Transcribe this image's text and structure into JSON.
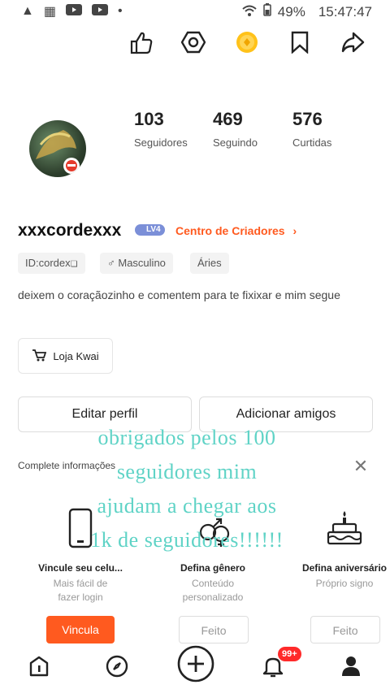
{
  "status_bar": {
    "battery": "49%",
    "time": "15:47:47"
  },
  "top_icons": [
    "like-icon",
    "settings-icon",
    "coin-icon",
    "bookmark-icon",
    "share-icon"
  ],
  "stats": [
    {
      "value": "103",
      "label": "Seguidores"
    },
    {
      "value": "469",
      "label": "Seguindo"
    },
    {
      "value": "576",
      "label": "Curtidas"
    }
  ],
  "profile": {
    "username": "xxxcordexxx",
    "level": "LV4",
    "creator_center": "Centro de Criadores",
    "chips": [
      "ID:cordex",
      "Masculino",
      "Áries"
    ],
    "bio": "deixem o coraçãozinho e comentem para te fixixar e mim segue",
    "shop_label": "Loja Kwai"
  },
  "actions": {
    "edit": "Editar perfil",
    "add_friends": "Adicionar amigos"
  },
  "complete_info": {
    "label": "Complete informações",
    "cards": [
      {
        "title": "Vincule seu celu...",
        "subtitle_1": "Mais fácil de",
        "subtitle_2": "fazer  login",
        "button": "Vincula"
      },
      {
        "title": "Defina gênero",
        "subtitle_1": "Conteúdo",
        "subtitle_2": "personalizado",
        "button": "Feito"
      },
      {
        "title": "Defina aniversário",
        "subtitle_1": "Próprio signo",
        "subtitle_2": "",
        "button": "Feito"
      }
    ]
  },
  "overlay_text": [
    "obrigados pelos 100",
    "seguidores mim",
    "ajudam a chegar aos",
    "1k de seguidores!!!!!!"
  ],
  "bottom_nav": {
    "badge": "99+"
  },
  "colors": {
    "accent": "#ff5a1f",
    "overlay": "#5fd3c6",
    "badge": "#ff2a2a"
  }
}
